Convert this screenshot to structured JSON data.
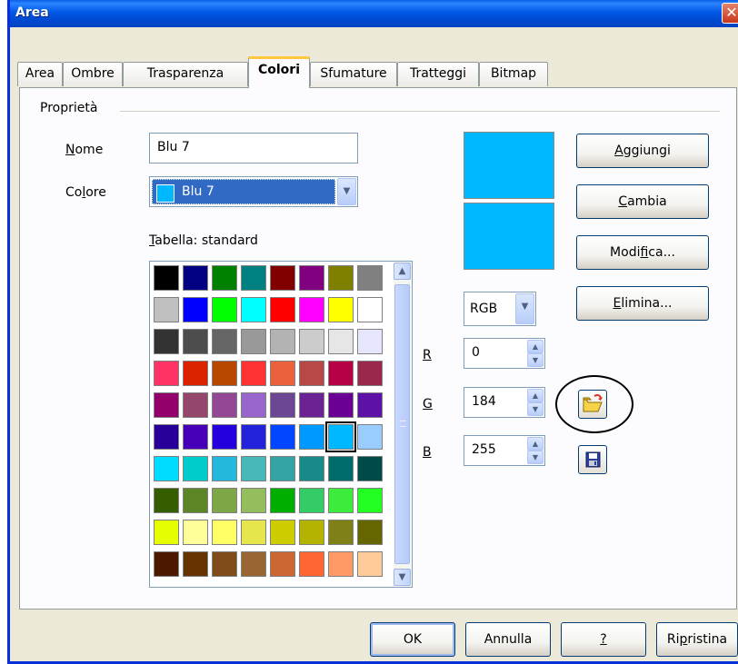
{
  "window": {
    "title": "Area",
    "close_glyph": "✕"
  },
  "tabs": [
    {
      "label": "Area",
      "active": false
    },
    {
      "label": "Ombre",
      "active": false
    },
    {
      "label": "Trasparenza",
      "active": false
    },
    {
      "label": "Colori",
      "active": true
    },
    {
      "label": "Sfumature",
      "active": false
    },
    {
      "label": "Tratteggi",
      "active": false
    },
    {
      "label": "Bitmap",
      "active": false
    }
  ],
  "properties": {
    "group_label": "Proprietà",
    "name": {
      "label_u": "N",
      "label_rest": "ome",
      "value": "Blu 7"
    },
    "color": {
      "label_pre": "Co",
      "label_u": "l",
      "label_rest": "ore",
      "value": "Blu 7",
      "swatch": "#00b8ff"
    },
    "table": {
      "label_u": "T",
      "label_rest": "abella: standard"
    }
  },
  "palette": [
    "#000000",
    "#000080",
    "#008000",
    "#008080",
    "#800000",
    "#800080",
    "#808000",
    "#808080",
    "#c0c0c0",
    "#0000ff",
    "#00ff00",
    "#00ffff",
    "#ff0000",
    "#ff00ff",
    "#ffff00",
    "#ffffff",
    "#333333",
    "#4d4d4d",
    "#666666",
    "#999999",
    "#b3b3b3",
    "#cccccc",
    "#e6e6e6",
    "#e6e6ff",
    "#ff3366",
    "#dc2300",
    "#b84700",
    "#ff3333",
    "#eb613d",
    "#b84747",
    "#b80047",
    "#99284c",
    "#94006b",
    "#94476b",
    "#944794",
    "#9966cc",
    "#6b4794",
    "#6b2394",
    "#6b0094",
    "#5e11a6",
    "#280099",
    "#4700b8",
    "#2300dc",
    "#2323dc",
    "#0047ff",
    "#0099ff",
    "#00b8ff",
    "#99ccff",
    "#00dcff",
    "#00cccc",
    "#23b8dc",
    "#47b8b8",
    "#33a3a3",
    "#198a8a",
    "#006b6b",
    "#004a4a",
    "#355e00",
    "#5c8526",
    "#7da647",
    "#94bd5e",
    "#00ae00",
    "#33cc66",
    "#3deb3d",
    "#23ff23",
    "#e6ff00",
    "#ffff99",
    "#ffff66",
    "#e6e64c",
    "#cccc00",
    "#b3b300",
    "#808019",
    "#666600",
    "#4c1900",
    "#663300",
    "#804c19",
    "#996633",
    "#cc6633",
    "#ff6633",
    "#ff9966",
    "#ffcc99"
  ],
  "selected_color_index": 46,
  "preview": {
    "top": "#00b8ff",
    "bottom": "#00b8ff"
  },
  "actions": {
    "add": {
      "label_u": "A",
      "label_rest": "ggiungi"
    },
    "change": {
      "label_u": "C",
      "label_rest": "ambia"
    },
    "edit": {
      "label_pre": "Modi",
      "label_u": "f",
      "label_rest": "ica..."
    },
    "delete": {
      "label_u": "E",
      "label_rest": "limina..."
    }
  },
  "color_model": {
    "value": "RGB"
  },
  "channels": {
    "r": {
      "label": "R",
      "value": "0"
    },
    "g": {
      "label": "G",
      "value": "184"
    },
    "b": {
      "label": "B",
      "value": "255"
    }
  },
  "footer": {
    "ok": "OK",
    "cancel": "Annulla",
    "help": "?",
    "reset_pre": "Ri",
    "reset_u": "p",
    "reset_rest": "ristina"
  },
  "icons": {
    "dropdown": "▼",
    "scroll_up": "▲",
    "scroll_down": "▼",
    "spin_up": "▲",
    "spin_down": "▼"
  }
}
